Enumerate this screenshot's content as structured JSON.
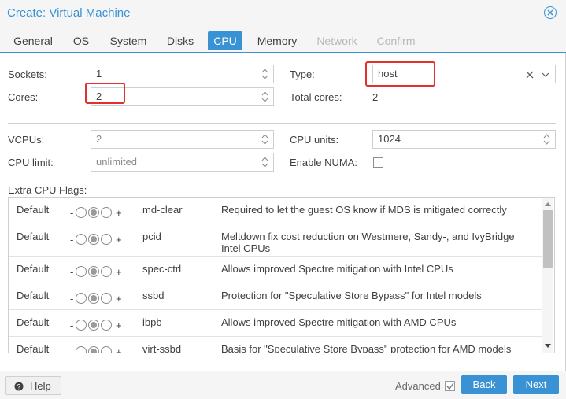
{
  "window": {
    "title": "Create: Virtual Machine",
    "close_icon": "close-circle-icon"
  },
  "tabs": [
    {
      "label": "General",
      "state": "normal"
    },
    {
      "label": "OS",
      "state": "normal"
    },
    {
      "label": "System",
      "state": "normal"
    },
    {
      "label": "Disks",
      "state": "normal"
    },
    {
      "label": "CPU",
      "state": "active"
    },
    {
      "label": "Memory",
      "state": "normal"
    },
    {
      "label": "Network",
      "state": "disabled"
    },
    {
      "label": "Confirm",
      "state": "disabled"
    }
  ],
  "form": {
    "sockets": {
      "label": "Sockets:",
      "value": "1"
    },
    "cores": {
      "label": "Cores:",
      "value": "2"
    },
    "type": {
      "label": "Type:",
      "value": "host"
    },
    "total_cores": {
      "label": "Total cores:",
      "value": "2"
    },
    "vcpus": {
      "label": "VCPUs:",
      "value": "2"
    },
    "cpu_units": {
      "label": "CPU units:",
      "value": "1024"
    },
    "cpu_limit": {
      "label": "CPU limit:",
      "value": "unlimited"
    },
    "enable_numa": {
      "label": "Enable NUMA:",
      "checked": false
    }
  },
  "flags": {
    "label": "Extra CPU Flags:",
    "rows": [
      {
        "state": "Default",
        "minus": "-",
        "plus": "+",
        "name": "md-clear",
        "desc": "Required to let the guest OS know if MDS is mitigated correctly"
      },
      {
        "state": "Default",
        "minus": "-",
        "plus": "+",
        "name": "pcid",
        "desc": "Meltdown fix cost reduction on Westmere, Sandy-, and IvyBridge Intel CPUs"
      },
      {
        "state": "Default",
        "minus": "-",
        "plus": "+",
        "name": "spec-ctrl",
        "desc": "Allows improved Spectre mitigation with Intel CPUs"
      },
      {
        "state": "Default",
        "minus": "-",
        "plus": "+",
        "name": "ssbd",
        "desc": "Protection for \"Speculative Store Bypass\" for Intel models"
      },
      {
        "state": "Default",
        "minus": "-",
        "plus": "+",
        "name": "ibpb",
        "desc": "Allows improved Spectre mitigation with AMD CPUs"
      },
      {
        "state": "Default",
        "minus": "-",
        "plus": "+",
        "name": "virt-ssbd",
        "desc": "Basis for \"Speculative Store Bypass\" protection for AMD models"
      }
    ]
  },
  "footer": {
    "help": "Help",
    "advanced": "Advanced",
    "advanced_checked": true,
    "back": "Back",
    "next": "Next"
  },
  "colors": {
    "accent": "#3892d4",
    "highlight": "#e0312c"
  }
}
